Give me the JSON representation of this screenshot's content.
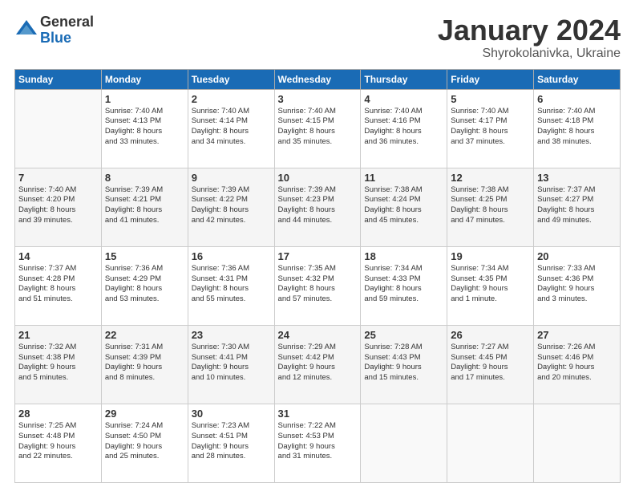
{
  "header": {
    "logo_general": "General",
    "logo_blue": "Blue",
    "month_title": "January 2024",
    "location": "Shyrokolanivka, Ukraine"
  },
  "days_of_week": [
    "Sunday",
    "Monday",
    "Tuesday",
    "Wednesday",
    "Thursday",
    "Friday",
    "Saturday"
  ],
  "weeks": [
    [
      {
        "day": "",
        "info": ""
      },
      {
        "day": "1",
        "info": "Sunrise: 7:40 AM\nSunset: 4:13 PM\nDaylight: 8 hours\nand 33 minutes."
      },
      {
        "day": "2",
        "info": "Sunrise: 7:40 AM\nSunset: 4:14 PM\nDaylight: 8 hours\nand 34 minutes."
      },
      {
        "day": "3",
        "info": "Sunrise: 7:40 AM\nSunset: 4:15 PM\nDaylight: 8 hours\nand 35 minutes."
      },
      {
        "day": "4",
        "info": "Sunrise: 7:40 AM\nSunset: 4:16 PM\nDaylight: 8 hours\nand 36 minutes."
      },
      {
        "day": "5",
        "info": "Sunrise: 7:40 AM\nSunset: 4:17 PM\nDaylight: 8 hours\nand 37 minutes."
      },
      {
        "day": "6",
        "info": "Sunrise: 7:40 AM\nSunset: 4:18 PM\nDaylight: 8 hours\nand 38 minutes."
      }
    ],
    [
      {
        "day": "7",
        "info": "Sunrise: 7:40 AM\nSunset: 4:20 PM\nDaylight: 8 hours\nand 39 minutes."
      },
      {
        "day": "8",
        "info": "Sunrise: 7:39 AM\nSunset: 4:21 PM\nDaylight: 8 hours\nand 41 minutes."
      },
      {
        "day": "9",
        "info": "Sunrise: 7:39 AM\nSunset: 4:22 PM\nDaylight: 8 hours\nand 42 minutes."
      },
      {
        "day": "10",
        "info": "Sunrise: 7:39 AM\nSunset: 4:23 PM\nDaylight: 8 hours\nand 44 minutes."
      },
      {
        "day": "11",
        "info": "Sunrise: 7:38 AM\nSunset: 4:24 PM\nDaylight: 8 hours\nand 45 minutes."
      },
      {
        "day": "12",
        "info": "Sunrise: 7:38 AM\nSunset: 4:25 PM\nDaylight: 8 hours\nand 47 minutes."
      },
      {
        "day": "13",
        "info": "Sunrise: 7:37 AM\nSunset: 4:27 PM\nDaylight: 8 hours\nand 49 minutes."
      }
    ],
    [
      {
        "day": "14",
        "info": "Sunrise: 7:37 AM\nSunset: 4:28 PM\nDaylight: 8 hours\nand 51 minutes."
      },
      {
        "day": "15",
        "info": "Sunrise: 7:36 AM\nSunset: 4:29 PM\nDaylight: 8 hours\nand 53 minutes."
      },
      {
        "day": "16",
        "info": "Sunrise: 7:36 AM\nSunset: 4:31 PM\nDaylight: 8 hours\nand 55 minutes."
      },
      {
        "day": "17",
        "info": "Sunrise: 7:35 AM\nSunset: 4:32 PM\nDaylight: 8 hours\nand 57 minutes."
      },
      {
        "day": "18",
        "info": "Sunrise: 7:34 AM\nSunset: 4:33 PM\nDaylight: 8 hours\nand 59 minutes."
      },
      {
        "day": "19",
        "info": "Sunrise: 7:34 AM\nSunset: 4:35 PM\nDaylight: 9 hours\nand 1 minute."
      },
      {
        "day": "20",
        "info": "Sunrise: 7:33 AM\nSunset: 4:36 PM\nDaylight: 9 hours\nand 3 minutes."
      }
    ],
    [
      {
        "day": "21",
        "info": "Sunrise: 7:32 AM\nSunset: 4:38 PM\nDaylight: 9 hours\nand 5 minutes."
      },
      {
        "day": "22",
        "info": "Sunrise: 7:31 AM\nSunset: 4:39 PM\nDaylight: 9 hours\nand 8 minutes."
      },
      {
        "day": "23",
        "info": "Sunrise: 7:30 AM\nSunset: 4:41 PM\nDaylight: 9 hours\nand 10 minutes."
      },
      {
        "day": "24",
        "info": "Sunrise: 7:29 AM\nSunset: 4:42 PM\nDaylight: 9 hours\nand 12 minutes."
      },
      {
        "day": "25",
        "info": "Sunrise: 7:28 AM\nSunset: 4:43 PM\nDaylight: 9 hours\nand 15 minutes."
      },
      {
        "day": "26",
        "info": "Sunrise: 7:27 AM\nSunset: 4:45 PM\nDaylight: 9 hours\nand 17 minutes."
      },
      {
        "day": "27",
        "info": "Sunrise: 7:26 AM\nSunset: 4:46 PM\nDaylight: 9 hours\nand 20 minutes."
      }
    ],
    [
      {
        "day": "28",
        "info": "Sunrise: 7:25 AM\nSunset: 4:48 PM\nDaylight: 9 hours\nand 22 minutes."
      },
      {
        "day": "29",
        "info": "Sunrise: 7:24 AM\nSunset: 4:50 PM\nDaylight: 9 hours\nand 25 minutes."
      },
      {
        "day": "30",
        "info": "Sunrise: 7:23 AM\nSunset: 4:51 PM\nDaylight: 9 hours\nand 28 minutes."
      },
      {
        "day": "31",
        "info": "Sunrise: 7:22 AM\nSunset: 4:53 PM\nDaylight: 9 hours\nand 31 minutes."
      },
      {
        "day": "",
        "info": ""
      },
      {
        "day": "",
        "info": ""
      },
      {
        "day": "",
        "info": ""
      }
    ]
  ]
}
